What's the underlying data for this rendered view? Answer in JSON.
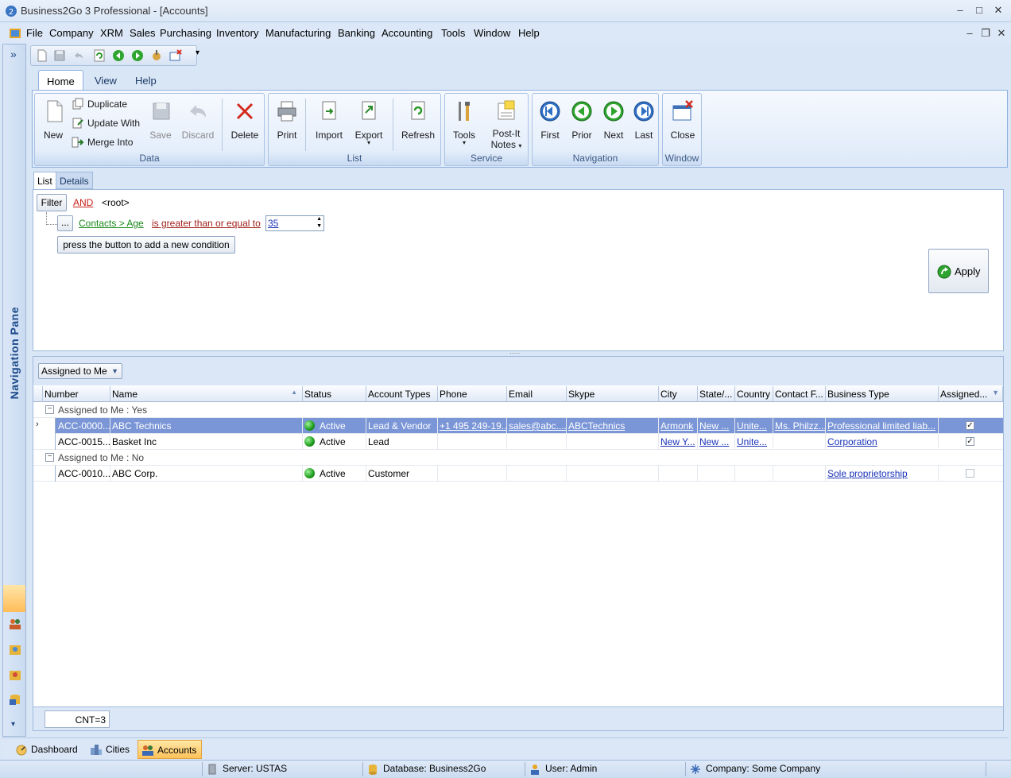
{
  "window": {
    "title": "Business2Go 3 Professional - [Accounts]"
  },
  "menu": [
    "File",
    "Company",
    "XRM",
    "Sales",
    "Purchasing",
    "Inventory",
    "Manufacturing",
    "Banking",
    "Accounting",
    "Tools",
    "Window",
    "Help"
  ],
  "nav_pane": {
    "label": "Navigation Pane",
    "expand_glyph": "»"
  },
  "ribbon": {
    "tabs": [
      "Home",
      "View",
      "Help"
    ],
    "data_group": {
      "label": "Data",
      "new": "New",
      "duplicate": "Duplicate",
      "update_with": "Update With",
      "merge_into": "Merge Into",
      "save": "Save",
      "discard": "Discard",
      "delete": "Delete"
    },
    "list_group": {
      "label": "List",
      "print": "Print",
      "import": "Import",
      "export": "Export",
      "refresh": "Refresh"
    },
    "service_group": {
      "label": "Service",
      "tools": "Tools",
      "postit1": "Post-It",
      "postit2": "Notes"
    },
    "navigation_group": {
      "label": "Navigation",
      "first": "First",
      "prior": "Prior",
      "next": "Next",
      "last": "Last"
    },
    "window_group": {
      "label": "Window",
      "close": "Close"
    }
  },
  "subtabs": {
    "list": "List",
    "details": "Details"
  },
  "filter": {
    "filter_label": "Filter",
    "operator": "AND",
    "root": "<root>",
    "ellipsis": "...",
    "field": "Contacts > Age",
    "condition": "is greater than or equal to",
    "value": "35",
    "add_hint": "press the button to add a new condition",
    "apply": "Apply"
  },
  "grid": {
    "group_by": "Assigned to Me",
    "columns": [
      "Number",
      "Name",
      "Status",
      "Account Types",
      "Phone",
      "Email",
      "Skype",
      "City",
      "State/...",
      "Country",
      "Contact F...",
      "Business Type",
      "Assigned..."
    ],
    "groups": [
      {
        "label": "Assigned to Me : Yes",
        "rows": [
          {
            "number": "ACC-0000...",
            "name": "ABC Technics",
            "status": "Active",
            "types": "Lead & Vendor",
            "phone": "+1 495 249-19...",
            "email": "sales@abc....",
            "skype": "ABCTechnics",
            "city": "Armonk",
            "state": "New ...",
            "country": "Unite...",
            "contact": "Ms. Philzz...",
            "business": "Professional limited liab...",
            "assigned": true
          },
          {
            "number": "ACC-0015...",
            "name": "Basket Inc",
            "status": "Active",
            "types": "Lead",
            "phone": "",
            "email": "",
            "skype": "",
            "city": "New Y...",
            "state": "New ...",
            "country": "Unite...",
            "contact": "",
            "business": "Corporation",
            "assigned": true
          }
        ]
      },
      {
        "label": "Assigned to Me : No",
        "rows": [
          {
            "number": "ACC-0010...",
            "name": "ABC Corp.",
            "status": "Active",
            "types": "Customer",
            "phone": "",
            "email": "",
            "skype": "",
            "city": "",
            "state": "",
            "country": "",
            "contact": "",
            "business": "Sole proprietorship",
            "assigned": false
          }
        ]
      }
    ],
    "count": "CNT=3"
  },
  "bottom_tabs": [
    "Dashboard",
    "Cities",
    "Accounts"
  ],
  "status": {
    "server": "Server: USTAS",
    "database": "Database: Business2Go",
    "user": "User: Admin",
    "company": "Company: Some Company"
  },
  "colors": {
    "selected_row": "#7b96d7",
    "active_tab": "#ffc25a",
    "link": "#1a33b8"
  }
}
